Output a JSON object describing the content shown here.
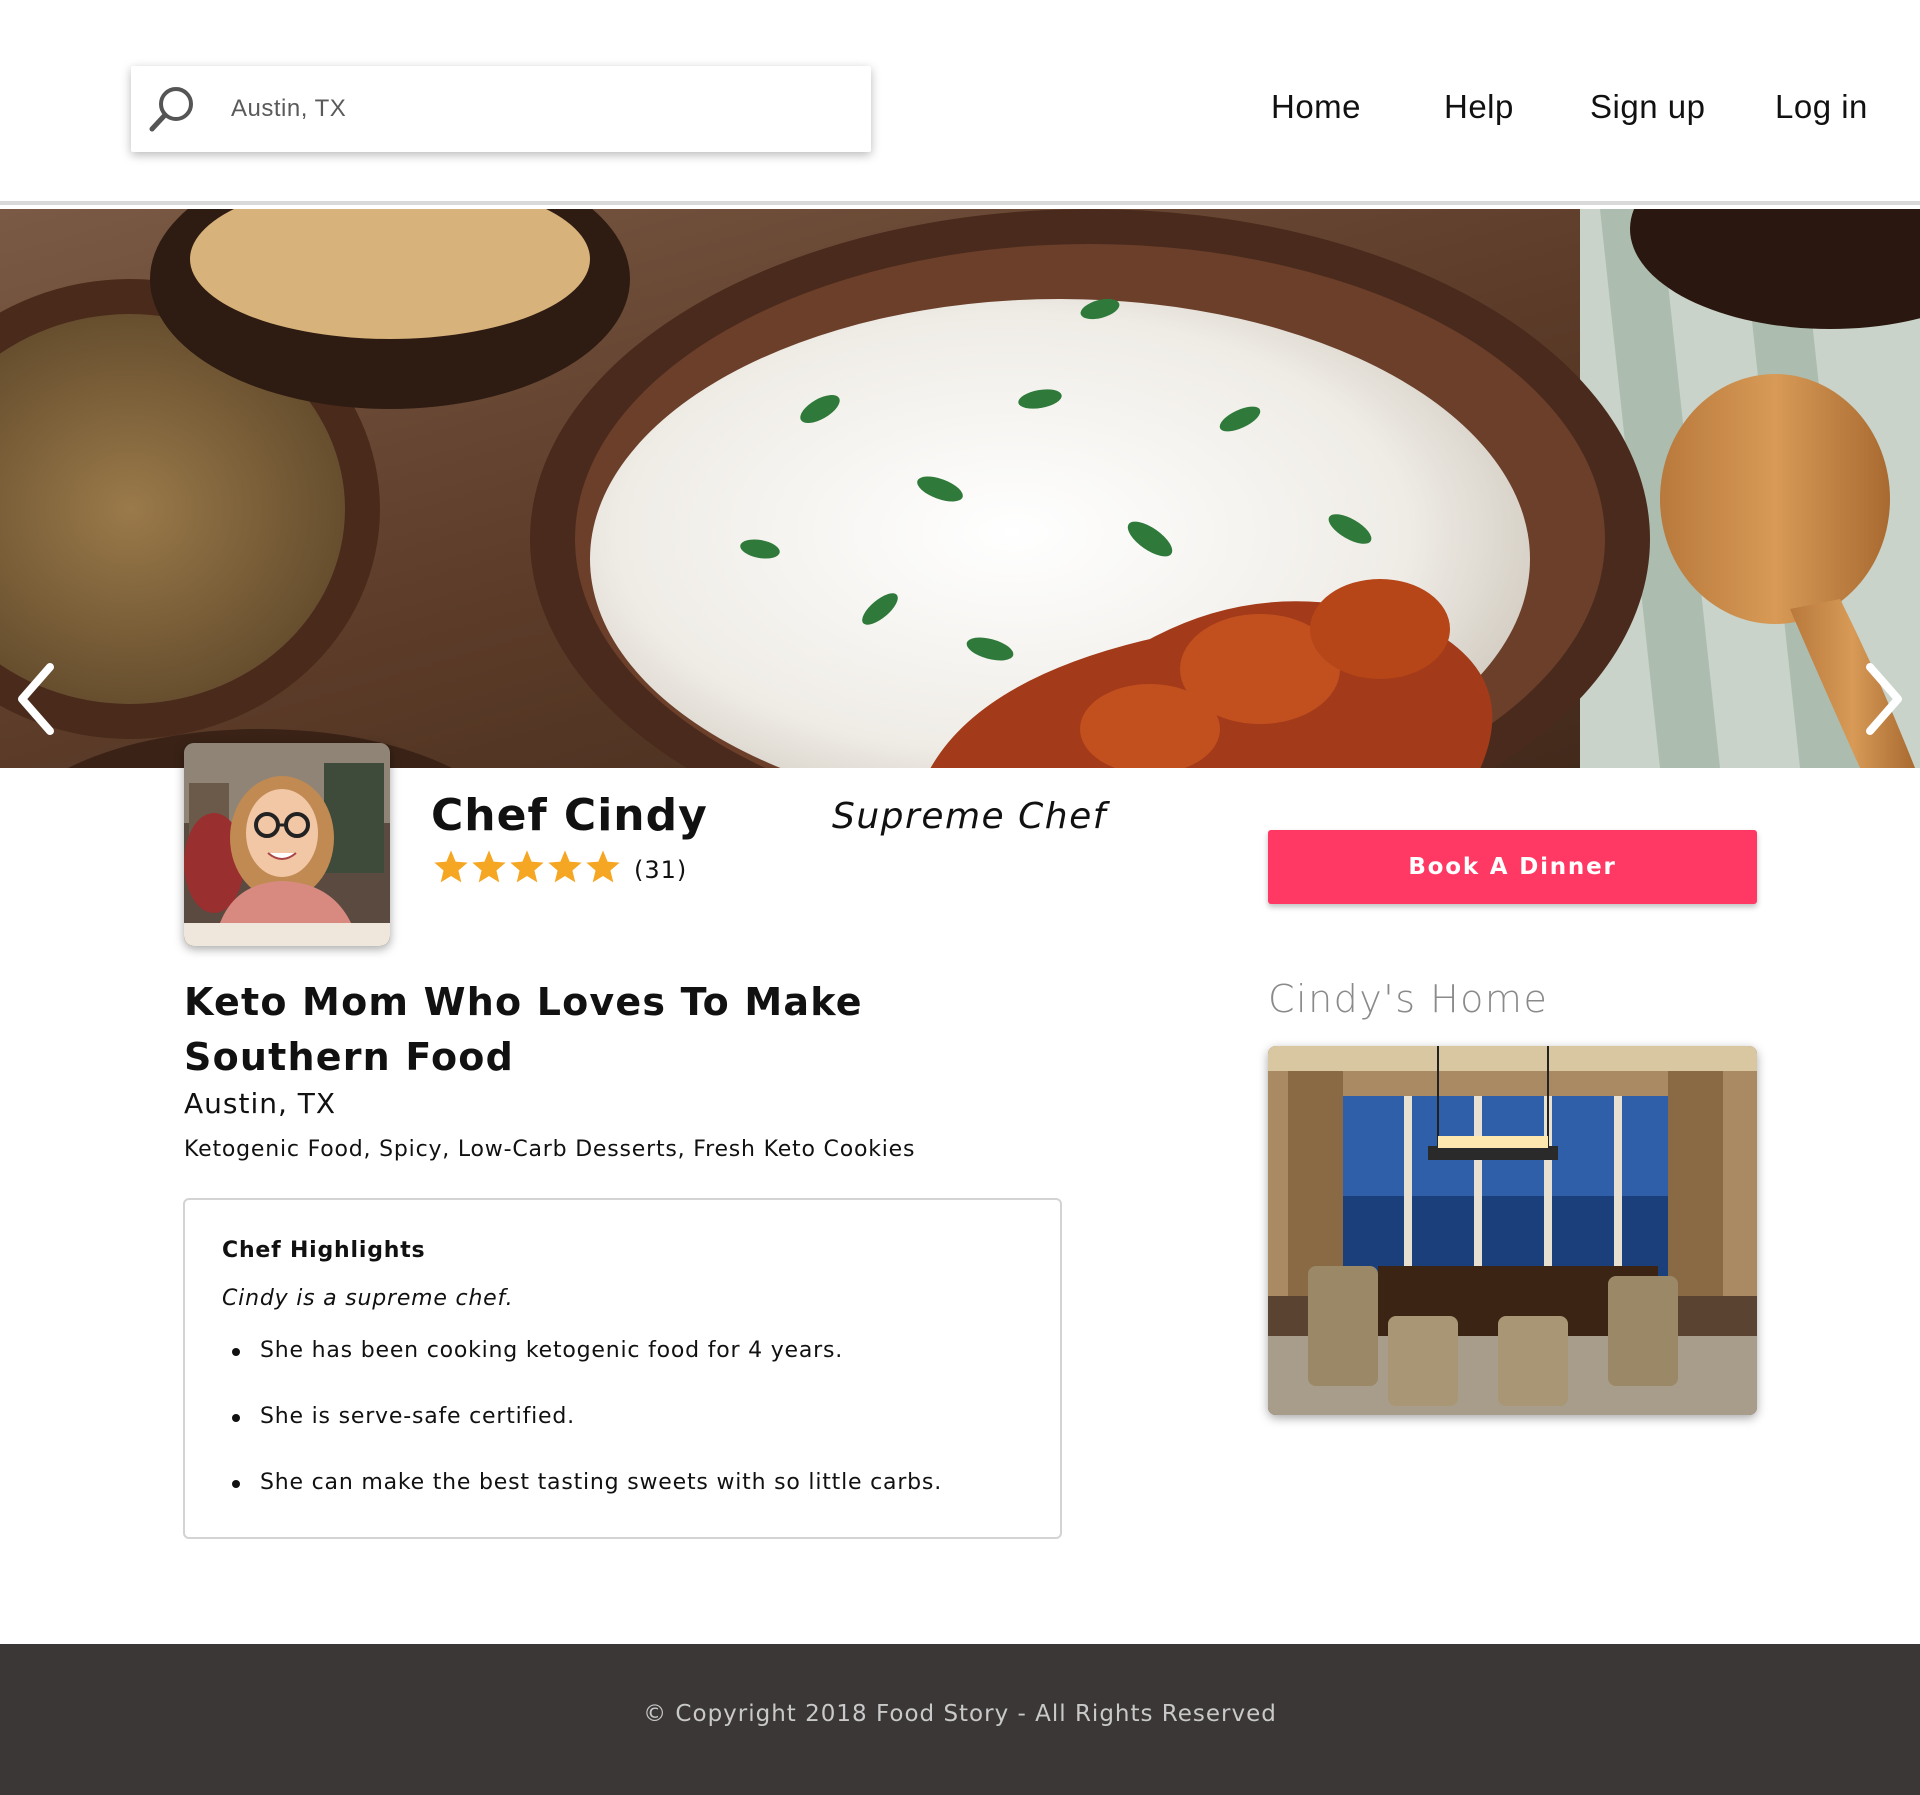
{
  "search": {
    "value": "Austin, TX",
    "icon": "search-icon"
  },
  "nav": {
    "items": [
      "Home",
      "Help",
      "Sign up",
      "Log in"
    ]
  },
  "hero": {
    "prev_icon": "chevron-left-icon",
    "next_icon": "chevron-right-icon"
  },
  "profile": {
    "name": "Chef Cindy",
    "rating": 5,
    "review_count": "(31)",
    "rank": "Supreme Chef",
    "headline": "Keto Mom Who Loves To Make Southern Food",
    "location": "Austin, TX",
    "specialties": "Ketogenic Food, Spicy, Low-Carb Desserts, Fresh Keto Cookies"
  },
  "actions": {
    "book_label": "Book A Dinner"
  },
  "highlights": {
    "title": "Chef Highlights",
    "intro": "Cindy is a supreme chef.",
    "items": [
      "She has been cooking ketogenic food for 4 years.",
      "She is serve-safe certified.",
      "She can make the best tasting sweets with so little carbs."
    ]
  },
  "home": {
    "title": "Cindy's Home"
  },
  "footer": {
    "copyright": "© Copyright 2018 Food Story - All Rights Reserved"
  },
  "colors": {
    "accent": "#ff3963",
    "star": "#f5a623",
    "footer_bg": "#3a3736"
  }
}
